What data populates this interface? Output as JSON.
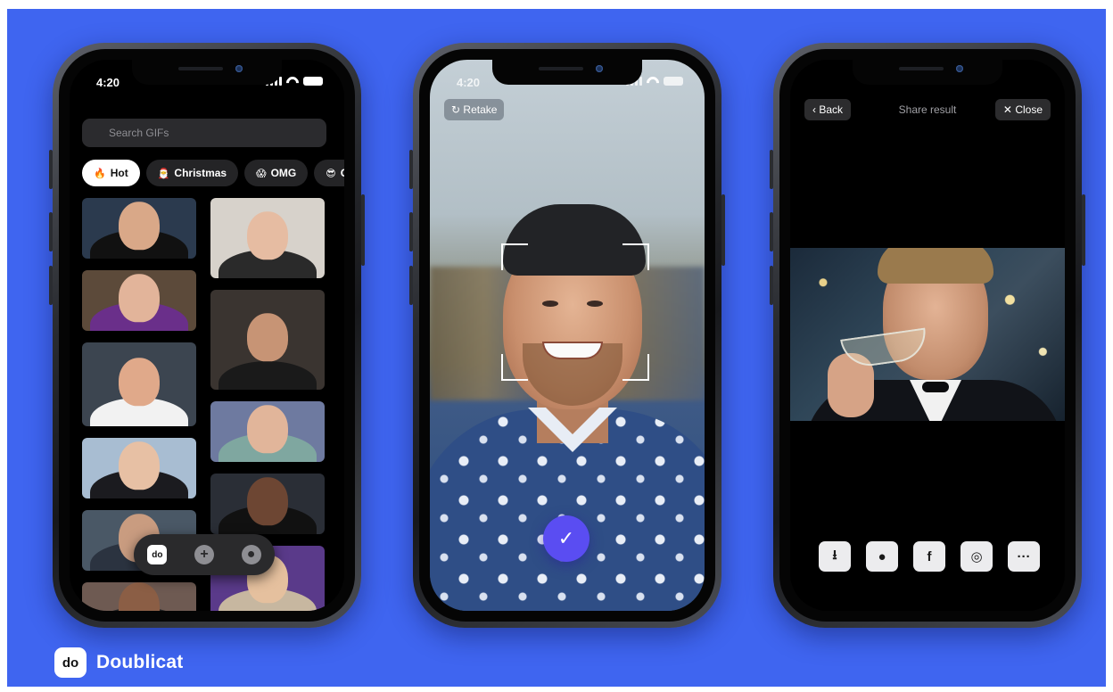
{
  "status_bar": {
    "time": "4:20"
  },
  "phone_1": {
    "search": {
      "placeholder": "Search GIFs"
    },
    "chips": [
      {
        "emoji": "🔥",
        "label": "Hot"
      },
      {
        "emoji": "🎅",
        "label": "Christmas"
      },
      {
        "emoji": "😱",
        "label": "OMG"
      },
      {
        "emoji": "😎",
        "label": "C"
      }
    ],
    "tabbar": {
      "home_glyph": "do",
      "add_glyph": "+",
      "profile_glyph": "●"
    },
    "gif_colors": {
      "left": [
        "#2b3a4e",
        "#5c4a3a",
        "#3c4550",
        "#a8bdd2",
        "#4a5866",
        "#6e5a52"
      ],
      "right": [
        "#d7d2cb",
        "#3a3430",
        "#6e7aa0",
        "#2a2e36",
        "#5a3a8a"
      ]
    }
  },
  "phone_2": {
    "retake_label": "Retake",
    "retake_icon": "↻",
    "confirm_icon": "✓"
  },
  "phone_3": {
    "back_label": "Back",
    "back_icon": "‹",
    "title": "Share result",
    "close_label": "Close",
    "close_icon": "✕",
    "share_icons": [
      "⭳",
      "●",
      "f",
      "◎",
      "···"
    ]
  },
  "brand": {
    "logo_text": "do",
    "name": "Doublicat"
  },
  "colors": {
    "background": "#3f65f0",
    "accent": "#5a4df2"
  }
}
